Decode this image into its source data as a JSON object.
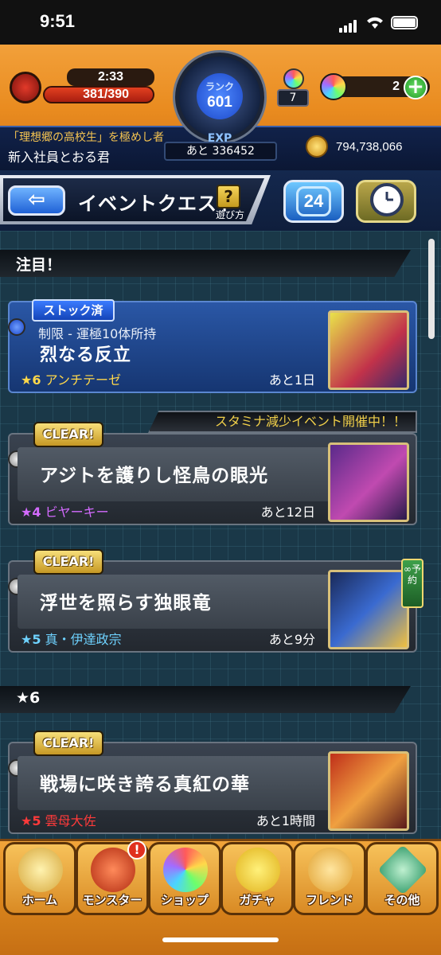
{
  "status_bar": {
    "time": "9:51"
  },
  "header": {
    "stamina_time": "2:33",
    "stamina": "381/390",
    "rank_label": "ランク",
    "rank": "601",
    "exp_label": "EXP",
    "exp_remaining": "あと 336452",
    "gem_count": "7",
    "orb_count": "2",
    "plus_label": "+",
    "title_line": "「理想郷の高校生」を極めし者",
    "user_name": "新入社員とおる君",
    "coins": "794,738,066"
  },
  "nav": {
    "back_label": "⇦",
    "title": "イベントクエスト",
    "help_icon": "?",
    "help_label": "遊び方",
    "badge_number": "24"
  },
  "sections": {
    "featured": "注目！",
    "star6": "★6"
  },
  "banner": "スタミナ減少イベント開催中！！",
  "quests": [
    {
      "tag": "ストック済",
      "subtitle": "制限 - 運極10体所持",
      "title": "烈なる反立",
      "star": "★6",
      "monster": "アンチテーゼ",
      "remaining": "あと1日",
      "star_color": "#ffd84a",
      "monster_color": "#ffd84a"
    },
    {
      "tag": "CLEAR!",
      "title": "アジトを護りし怪鳥の眼光",
      "star": "★4",
      "monster": "ビヤーキー",
      "remaining": "あと12日",
      "star_color": "#d46bff",
      "monster_color": "#d46bff"
    },
    {
      "tag": "CLEAR!",
      "title": "浮世を照らす独眼竜",
      "star": "★5",
      "monster": "真・伊達政宗",
      "remaining": "あと9分",
      "star_color": "#6ed2ff",
      "monster_color": "#6ed2ff",
      "reserve_tag": "∞予約"
    },
    {
      "tag": "CLEAR!",
      "title": "戦場に咲き誇る真紅の華",
      "star": "★5",
      "monster": "雲母大佐",
      "remaining": "あと1時間",
      "star_color": "#ff3a3a",
      "monster_color": "#ff3a3a"
    }
  ],
  "bottom_nav": [
    {
      "label": "ホーム",
      "icon": "home-icon"
    },
    {
      "label": "モンスター",
      "icon": "monster-icon"
    },
    {
      "label": "ショップ",
      "icon": "shop-icon"
    },
    {
      "label": "ガチャ",
      "icon": "gacha-icon"
    },
    {
      "label": "フレンド",
      "icon": "friend-icon"
    },
    {
      "label": "その他",
      "icon": "other-icon"
    }
  ],
  "notification_badge": "!"
}
